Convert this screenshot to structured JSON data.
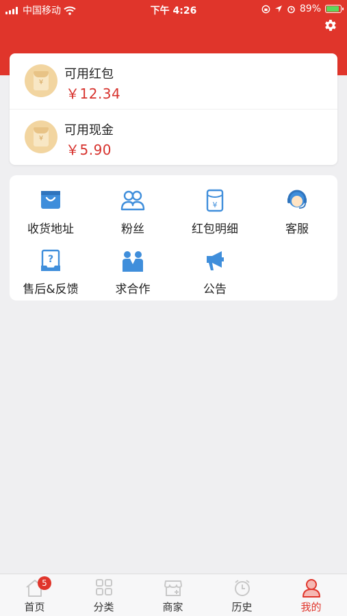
{
  "status_bar": {
    "carrier": "中国移动",
    "time": "下午 4:26",
    "battery": "89%"
  },
  "header": {
    "settings_icon": "gear-icon"
  },
  "wallet": {
    "items": [
      {
        "label": "可用红包",
        "amount": "￥12.34",
        "icon": "red-packet-icon"
      },
      {
        "label": "可用现金",
        "amount": "￥5.90",
        "icon": "cash-icon"
      }
    ]
  },
  "menu": {
    "items": [
      {
        "label": "收货地址",
        "icon": "shopping-bag-icon"
      },
      {
        "label": "粉丝",
        "icon": "fans-icon"
      },
      {
        "label": "红包明细",
        "icon": "red-packet-detail-icon"
      },
      {
        "label": "客服",
        "icon": "customer-service-icon"
      },
      {
        "label": "售后&反馈",
        "icon": "feedback-icon"
      },
      {
        "label": "求合作",
        "icon": "cooperation-icon"
      },
      {
        "label": "公告",
        "icon": "megaphone-icon"
      }
    ]
  },
  "tabbar": {
    "items": [
      {
        "label": "首页",
        "icon": "home-icon",
        "badge": "5"
      },
      {
        "label": "分类",
        "icon": "category-icon"
      },
      {
        "label": "商家",
        "icon": "store-icon"
      },
      {
        "label": "历史",
        "icon": "clock-icon"
      },
      {
        "label": "我的",
        "icon": "profile-icon"
      }
    ],
    "active_index": 4,
    "active_color": "#e0352b"
  },
  "colors": {
    "brand": "#e0352b",
    "icon_blue": "#3f8edb",
    "amount_red": "#d7322d",
    "background": "#efeff1"
  }
}
